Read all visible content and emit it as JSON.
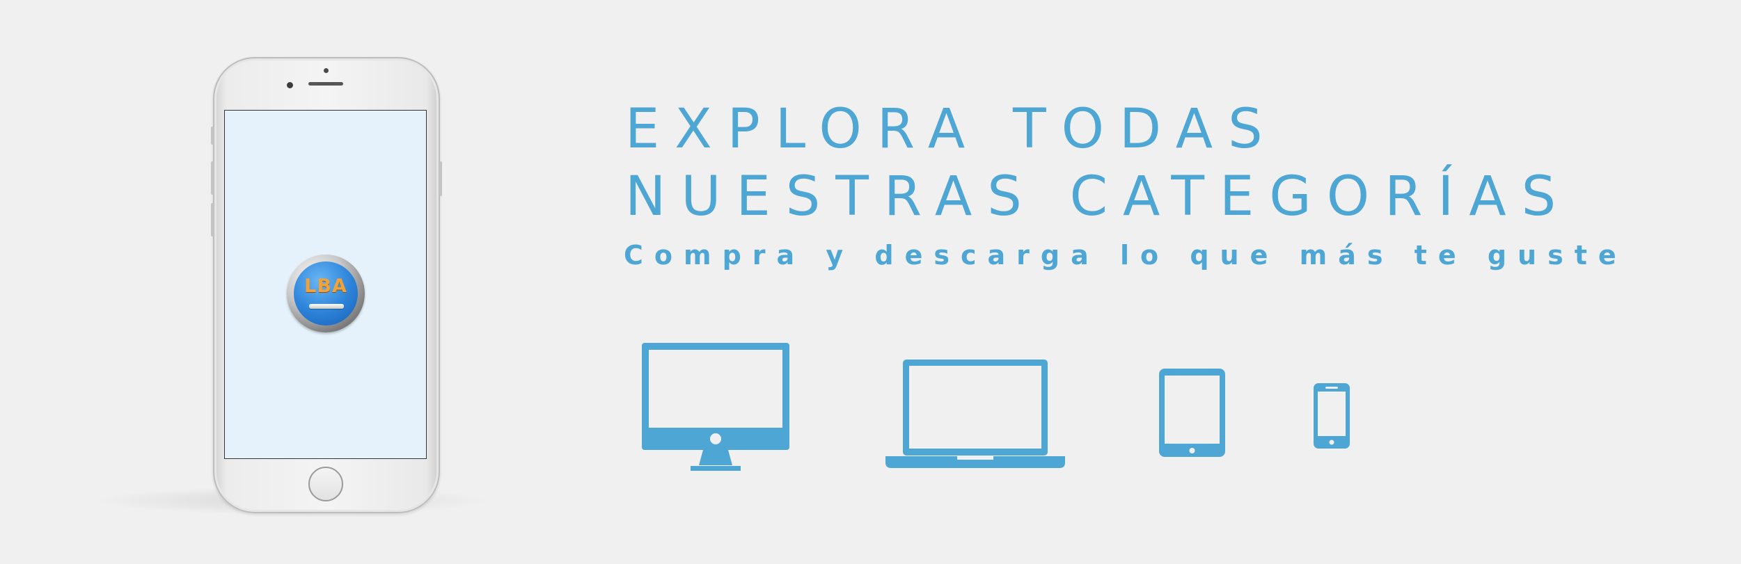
{
  "headline": {
    "line1": "EXPLORA TODAS",
    "line2": "NUESTRAS CATEGORÍAS"
  },
  "subline": "Compra y descarga lo que más te guste",
  "app_logo": {
    "text": "LBA"
  },
  "devices": [
    {
      "icon": "desktop-monitor-icon"
    },
    {
      "icon": "laptop-icon"
    },
    {
      "icon": "tablet-icon"
    },
    {
      "icon": "smartphone-icon"
    }
  ],
  "colors": {
    "accent": "#4da6d4",
    "background": "#f0f0f0",
    "screen": "#e5f2fb",
    "logo_orange": "#f2a23a",
    "logo_blue": "#2f86db"
  }
}
